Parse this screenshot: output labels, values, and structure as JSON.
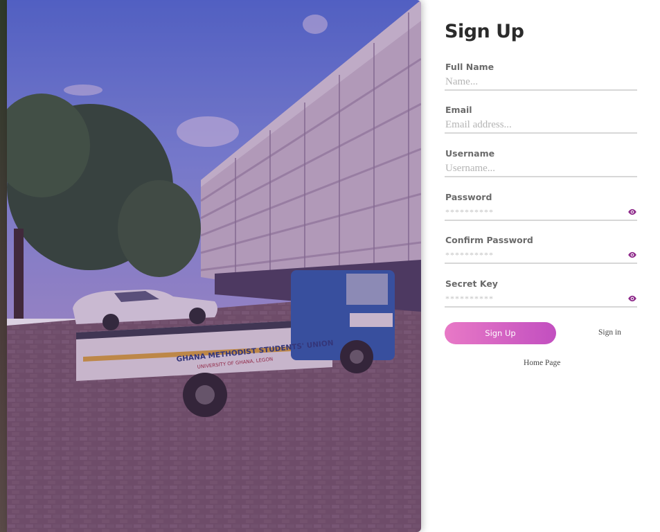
{
  "title": "Sign Up",
  "fields": [
    {
      "label": "Full Name",
      "placeholder": "Name...",
      "value": ""
    },
    {
      "label": "Email",
      "placeholder": "Email address...",
      "value": ""
    },
    {
      "label": "Username",
      "placeholder": "Username...",
      "value": ""
    },
    {
      "label": "Password",
      "placeholder": "**********",
      "value": "",
      "icon": "eye-icon"
    },
    {
      "label": "Confirm Password",
      "placeholder": "**********",
      "value": "",
      "icon": "eye-icon"
    },
    {
      "label": "Secret Key",
      "placeholder": "**********",
      "value": "",
      "icon": "eye-icon"
    }
  ],
  "buttons": {
    "signup_label": "Sign Up",
    "signin_label": "Sign in",
    "home_label": "Home Page"
  },
  "photo": {
    "truck_text_line1": "GHANA METHODIST STUDENTS' UNION",
    "truck_text_line2": "UNIVERSITY OF GHANA, LEGON"
  },
  "colors": {
    "accent_start": "#e879c6",
    "accent_end": "#c24fc0",
    "eye_icon": "#8e2a8a",
    "photo_tint": "#5a2a7a"
  }
}
